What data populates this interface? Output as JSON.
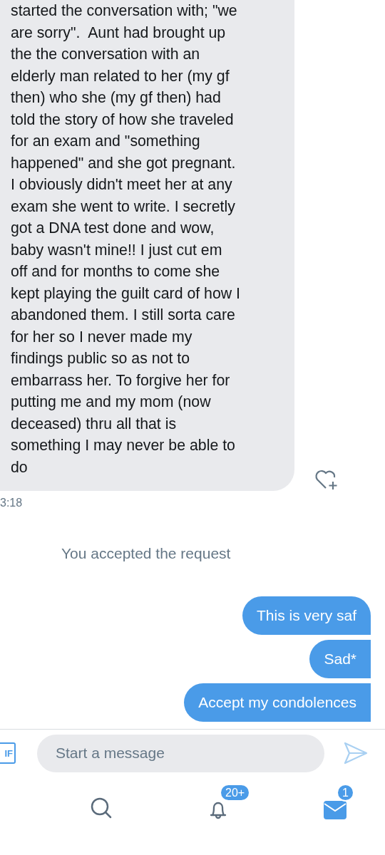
{
  "received": {
    "text": "started the conversation with; \"we\nare sorry\".  Aunt had brought up\nthe the conversation with an\nelderly man related to her (my gf\nthen) who she (my gf then) had\ntold the story of how she traveled\nfor an exam and \"something\nhappened\" and she got pregnant.\nI obviously didn't meet her at any\nexam she went to write. I secretly\ngot a DNA test done and wow,\nbaby wasn't mine!! I just cut em\noff and for months to come she\nkept playing the guilt card of how I\nabandoned them. I still sorta care\nfor her so I never made my\nfindings public so as not to\nembarrass her. To forgive her for\nputting me and my mom (now\ndeceased) thru all that is\nsomething I may never be able to\ndo",
    "time": "3:18"
  },
  "notice": "You accepted the request",
  "sent": [
    {
      "text": "This is very saf"
    },
    {
      "text": "Sad*"
    },
    {
      "text": "Accept my condolences"
    }
  ],
  "composer": {
    "gif_label": "IF",
    "placeholder": "Start a message"
  },
  "tab_bar": [
    {
      "kind": "search"
    },
    {
      "kind": "notifications",
      "badge": "20+"
    },
    {
      "kind": "messages",
      "badge": "1",
      "selected": true
    }
  ]
}
